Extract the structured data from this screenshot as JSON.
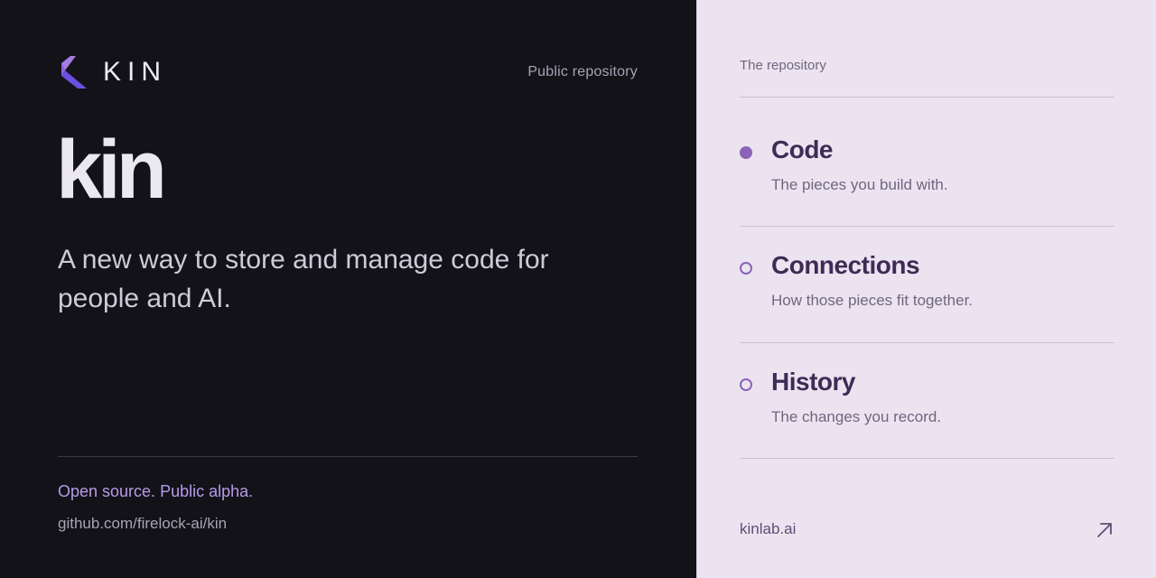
{
  "left": {
    "brand_name": "KIN",
    "top_tag": "Public repository",
    "hero_title": "kin",
    "hero_subtitle": "A new way to store and manage code for people and AI.",
    "footer_status": "Open source. Public alpha.",
    "footer_repo": "github.com/firelock-ai/kin"
  },
  "right": {
    "label": "The repository",
    "items": [
      {
        "title": "Code",
        "description": "The pieces you build with.",
        "bullet": "filled-circle-icon"
      },
      {
        "title": "Connections",
        "description": "How those pieces fit together.",
        "bullet": "open-circle-icon"
      },
      {
        "title": "History",
        "description": "The changes you record.",
        "bullet": "open-circle-icon"
      }
    ],
    "site_link": "kinlab.ai",
    "link_icon": "arrow-up-right-icon"
  },
  "colors": {
    "dark_bg": "#121218",
    "light_bg": "#ebe4f0",
    "accent": "#8c63b8",
    "logo_top": "#a47de0",
    "logo_bottom": "#6b4fe0"
  }
}
